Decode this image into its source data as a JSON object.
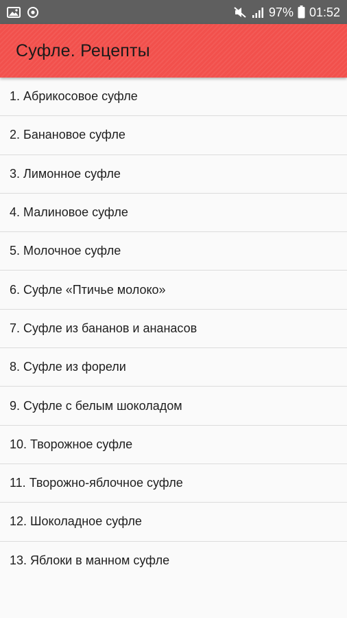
{
  "status_bar": {
    "battery": "97%",
    "time": "01:52",
    "icons": [
      "image-notification-icon",
      "sync-notification-icon",
      "mute-icon",
      "signal-icon",
      "battery-icon"
    ]
  },
  "app_bar": {
    "title": "Суфле. Рецепты",
    "color": "#f2504c"
  },
  "recipes": [
    "1. Абрикосовое суфле",
    "2. Банановое суфле",
    "3. Лимонное суфле",
    "4. Малиновое суфле",
    "5. Молочное суфле",
    "6. Суфле «Птичье молоко»",
    "7. Суфле из бананов и ананасов",
    "8. Суфле из форели",
    "9. Суфле с белым шоколадом",
    "10. Творожное суфле",
    "11. Творожно-яблочное суфле",
    "12. Шоколадное суфле",
    "13. Яблоки в манном суфле"
  ]
}
